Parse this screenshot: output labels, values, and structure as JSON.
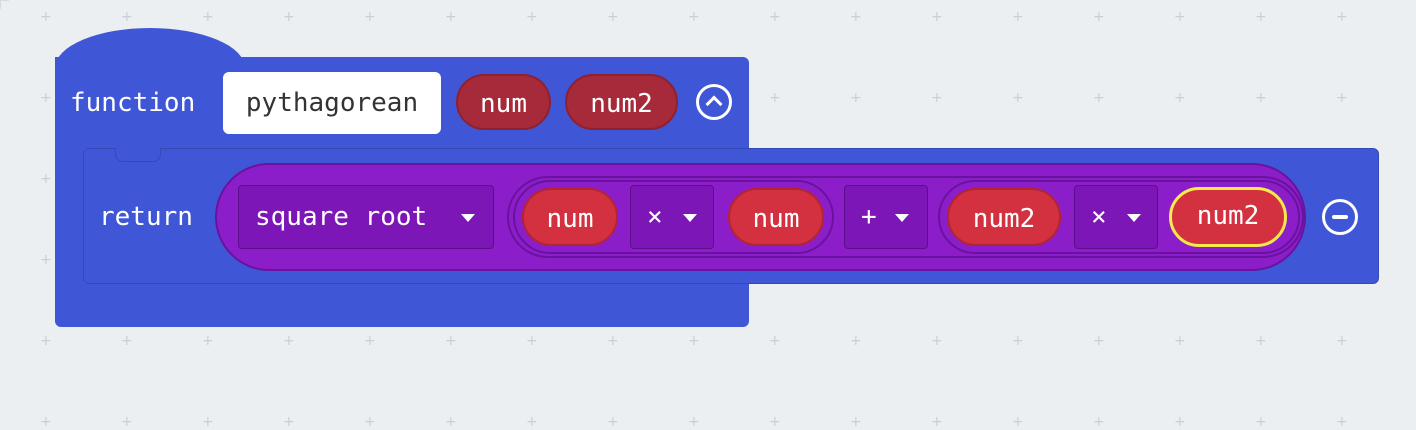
{
  "function_block": {
    "keyword": "function",
    "name": "pythagorean",
    "params": [
      "num",
      "num2"
    ],
    "collapse_icon": "chevron-up-circle-icon"
  },
  "return_block": {
    "keyword": "return",
    "math_op": "square root",
    "first_product": {
      "left": "num",
      "operator": "×",
      "right": "num"
    },
    "sum_operator": "+",
    "second_product": {
      "left": "num2",
      "operator": "×",
      "right": "num2"
    },
    "remove_icon": "minus-circle-icon"
  },
  "colors": {
    "function_block": "#3f57d6",
    "math_block": "#8c1ec9",
    "variable": "#d3313f",
    "parameter": "#a62a3a",
    "selection": "#f5e94c",
    "workspace": "#ebeff1"
  }
}
